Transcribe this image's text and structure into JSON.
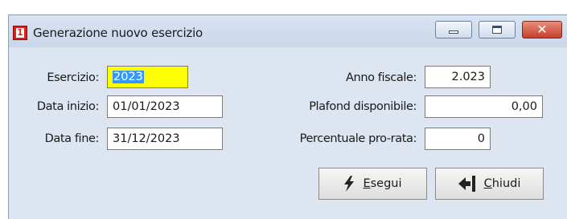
{
  "window": {
    "title": "Generazione nuovo esercizio",
    "app_icon_text": "1",
    "minimize_icon": "minimize-icon",
    "maximize_icon": "maximize-icon",
    "close_icon": "close-icon",
    "close_glyph": "✕"
  },
  "form": {
    "esercizio": {
      "label": "Esercizio:",
      "value": "2023"
    },
    "data_inizio": {
      "label": "Data inizio:",
      "value": "01/01/2023"
    },
    "data_fine": {
      "label": "Data fine:",
      "value": "31/12/2023"
    },
    "anno_fiscale": {
      "label": "Anno fiscale:",
      "value": "2.023"
    },
    "plafond": {
      "label": "Plafond disponibile:",
      "value": "0,00"
    },
    "pro_rata": {
      "label": "Percentuale pro-rata:",
      "value": "0"
    }
  },
  "buttons": {
    "esegui": {
      "mnemonic": "E",
      "rest": "segui",
      "icon": "lightning-icon"
    },
    "chiudi": {
      "mnemonic": "C",
      "rest": "hiudi",
      "icon": "exit-arrow-icon"
    }
  },
  "colors": {
    "highlight_field": "#ffff00",
    "selection": "#3399ff",
    "window_bg": "#dde5f0"
  }
}
